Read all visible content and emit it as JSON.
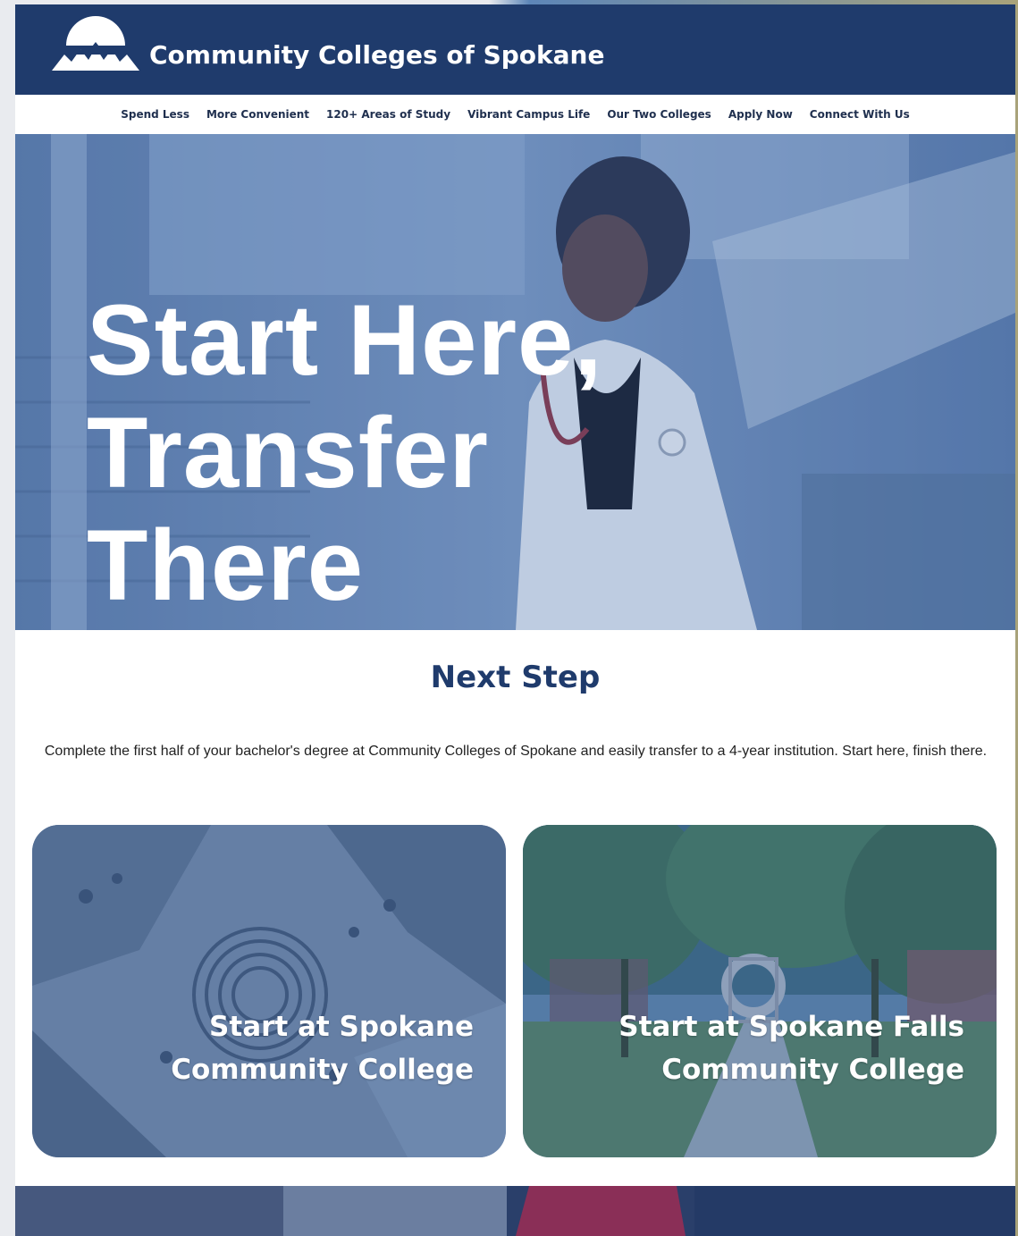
{
  "header": {
    "brand": "Community Colleges of Spokane",
    "logo_icon": "mountain-logo-icon"
  },
  "nav": {
    "items": [
      "Spend Less",
      "More Convenient",
      "120+ Areas of Study",
      "Vibrant Campus Life",
      "Our Two Colleges",
      "Apply Now",
      "Connect With Us"
    ]
  },
  "hero": {
    "title_lines": [
      "Start Here,",
      "Transfer",
      "There"
    ]
  },
  "next_step": {
    "title": "Next Step",
    "text": "Complete the first half of your bachelor's degree at Community Colleges of Spokane and easily transfer to a 4-year institution. Start here, finish there."
  },
  "cards": [
    {
      "line1": "Start at Spokane",
      "line2": "Community College"
    },
    {
      "line1": "Start at Spokane Falls",
      "line2": "Community College"
    }
  ],
  "colors": {
    "brand_navy": "#1f3b6c",
    "hero_tint": "#6f8fbd",
    "text": "#222222"
  }
}
